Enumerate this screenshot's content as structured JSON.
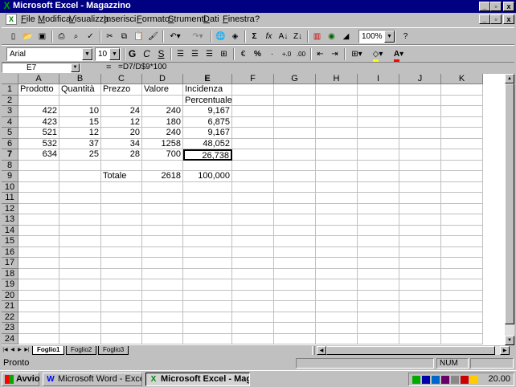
{
  "window": {
    "title": "Microsoft Excel - Magazzino",
    "minimize": "_",
    "maximize": "▫",
    "close": "x"
  },
  "menu": [
    "File",
    "Modifica",
    "Visualizza",
    "Inserisci",
    "Formato",
    "Strumenti",
    "Dati",
    "Finestra",
    "?"
  ],
  "toolbar": {
    "zoom": "100%",
    "font": "Arial",
    "font_size": "10",
    "bold": "G",
    "italic": "C",
    "underline": "S",
    "sum": "Σ",
    "fx": "fx",
    "percent": "%",
    "accent_colors": {
      "fill": "#ffff00",
      "font": "#ff0000"
    }
  },
  "formula_bar": {
    "cell_ref": "E7",
    "equals": "=",
    "formula": "=D7/D$9*100"
  },
  "grid": {
    "columns": [
      "A",
      "B",
      "C",
      "D",
      "E",
      "F",
      "G",
      "H",
      "I",
      "J",
      "K"
    ],
    "rows": [
      "1",
      "2",
      "3",
      "4",
      "5",
      "6",
      "7",
      "8",
      "9",
      "10",
      "11",
      "12",
      "13",
      "14",
      "15",
      "16",
      "17",
      "18",
      "19",
      "20",
      "21",
      "22",
      "23",
      "24"
    ],
    "selected_cell": "E7",
    "cells": {
      "A1": "Prodotto",
      "B1": "Quantità",
      "C1": "Prezzo",
      "D1": "Valore",
      "E1": "Incidenza",
      "E2": "Percentuale",
      "A3": "422",
      "B3": "10",
      "C3": "24",
      "D3": "240",
      "E3": "9,167",
      "A4": "423",
      "B4": "15",
      "C4": "12",
      "D4": "180",
      "E4": "6,875",
      "A5": "521",
      "B5": "12",
      "C5": "20",
      "D5": "240",
      "E5": "9,167",
      "A6": "532",
      "B6": "37",
      "C6": "34",
      "D6": "1258",
      "E6": "48,052",
      "A7": "634",
      "B7": "25",
      "C7": "28",
      "D7": "700",
      "E7": "26,738",
      "C9": "Totale",
      "D9": "2618",
      "E9": "100,000"
    }
  },
  "sheets": [
    "Foglio1",
    "Foglio2",
    "Foglio3"
  ],
  "active_sheet": "Foglio1",
  "status": {
    "text": "Pronto",
    "num": "NUM"
  },
  "taskbar": {
    "start": "Avvio",
    "items": [
      {
        "label": "Microsoft Word - Excel",
        "active": false
      },
      {
        "label": "Microsoft Excel - Mag...",
        "active": true
      }
    ],
    "clock": "20.00"
  }
}
